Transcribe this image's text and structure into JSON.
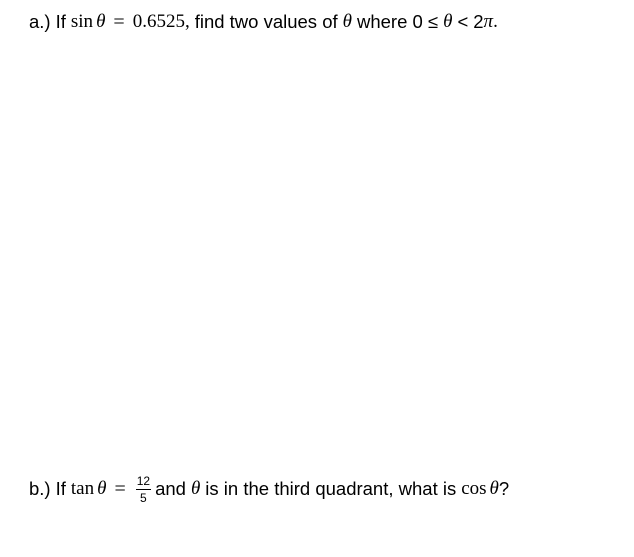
{
  "questions": [
    {
      "label": "a.)",
      "intro": "If",
      "func": "sin",
      "var": "θ",
      "equals": "=",
      "value": "0.6525,",
      "text1": "find two values of",
      "var2": "θ",
      "text2": "where 0 ≤",
      "var3": "θ",
      "text3": "<",
      "range_end": "2",
      "pi": "π",
      "period": "."
    },
    {
      "label": "b.)",
      "intro": "If",
      "func": "tan",
      "var": "θ",
      "equals": "=",
      "fraction": {
        "numerator": "12",
        "denominator": "5"
      },
      "text1": "and",
      "var2": "θ",
      "text2": "is in the third quadrant, what is",
      "func2": "cos",
      "var3": "θ",
      "end": "?"
    }
  ]
}
